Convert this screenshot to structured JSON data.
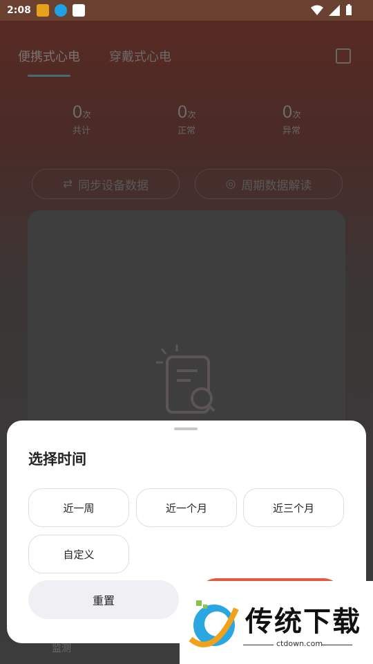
{
  "status": {
    "time": "2:08"
  },
  "tabs": [
    {
      "label": "便携式心电"
    },
    {
      "label": "穿戴式心电"
    }
  ],
  "stats": [
    {
      "value": "0",
      "unit": "次",
      "label": "共计"
    },
    {
      "value": "0",
      "unit": "次",
      "label": "正常"
    },
    {
      "value": "0",
      "unit": "次",
      "label": "异常"
    }
  ],
  "actions": {
    "sync": "同步设备数据",
    "interpret": "周期数据解读"
  },
  "sheet": {
    "title": "选择时间",
    "options": [
      "近一周",
      "近一个月",
      "近三个月",
      "自定义"
    ],
    "reset_label": "重置"
  },
  "bottom_nav": {
    "monitor_label": "监测"
  },
  "watermark": {
    "title": "传统下载",
    "url": "ctdown.com"
  },
  "colors": {
    "accent": "#e45a3c",
    "tab_indicator": "#3f6f6e"
  }
}
